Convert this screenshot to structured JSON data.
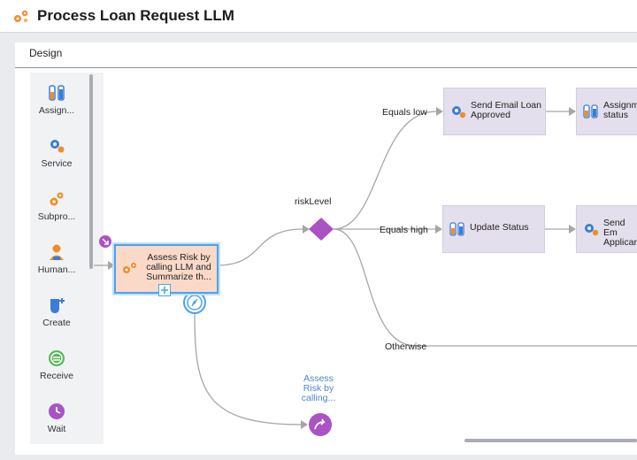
{
  "app": {
    "title": "Process Loan Request LLM"
  },
  "tabs": [
    {
      "label": "Design"
    }
  ],
  "palette": [
    {
      "label": "Assign...",
      "icon": "assignment-icon"
    },
    {
      "label": "Service",
      "icon": "service-icon"
    },
    {
      "label": "Subpro...",
      "icon": "subprocess-icon"
    },
    {
      "label": "Human...",
      "icon": "human-task-icon"
    },
    {
      "label": "Create",
      "icon": "create-event-icon"
    },
    {
      "label": "Receive",
      "icon": "receive-event-icon"
    },
    {
      "label": "Wait",
      "icon": "wait-timer-icon"
    }
  ],
  "nodes": {
    "assess_risk": "Assess Risk by calling LLM and Summarize th...",
    "gateway": "riskLevel",
    "send_email_approved": "Send Email Loan Approved",
    "assignment_status": "Assignm status",
    "update_status": "Update Status",
    "send_email_applicant": "Send Em Applicar",
    "end_event": "Assess Risk by calling..."
  },
  "edges": {
    "equals_low": "Equals low",
    "equals_high": "Equals high",
    "otherwise": "Otherwise"
  },
  "colors": {
    "accent": "#f28c28",
    "task_fill": "#e3dfec",
    "selected_fill": "#fbd9c8",
    "gateway": "#a953c4",
    "selection": "#4aa3ec",
    "connector": "#a6a6a6"
  }
}
